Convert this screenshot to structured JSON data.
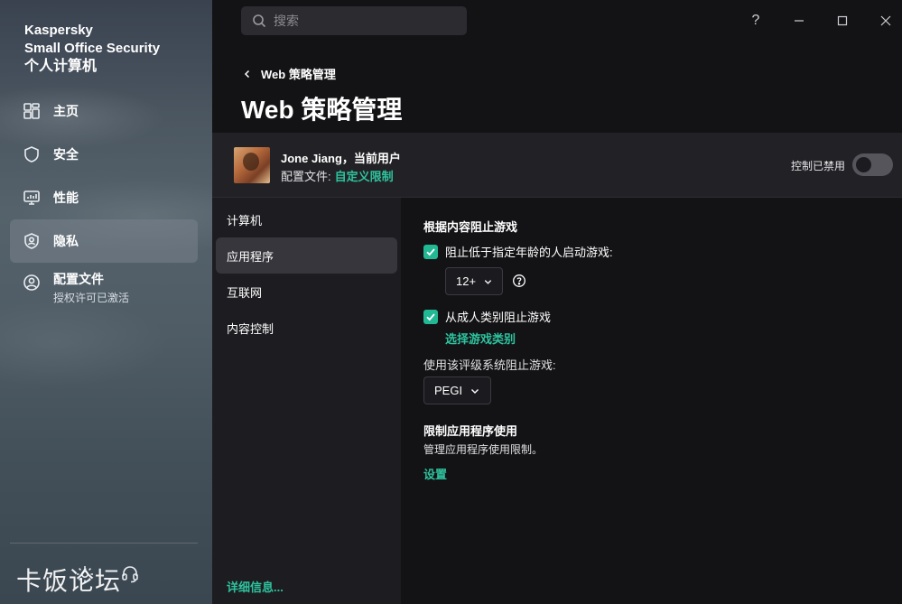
{
  "brand": {
    "line1": "Kaspersky",
    "line2": "Small Office Security",
    "line3": "个人计算机"
  },
  "sidebar": {
    "items": [
      {
        "label": "主页",
        "icon": "dashboard-icon"
      },
      {
        "label": "安全",
        "icon": "shield-icon"
      },
      {
        "label": "性能",
        "icon": "monitor-icon"
      },
      {
        "label": "隐私",
        "icon": "privacy-shield-icon",
        "active": true
      },
      {
        "label": "配置文件",
        "sublabel": "授权许可已激活",
        "icon": "user-circle-icon"
      }
    ],
    "footer_icons": [
      "settings-icon",
      "support-headset-icon"
    ],
    "watermark": "卡饭论坛"
  },
  "search": {
    "placeholder": "搜索"
  },
  "window_controls": {
    "help": "?",
    "minimize": "—",
    "maximize": "□",
    "close": "✕"
  },
  "header": {
    "breadcrumb": "Web 策略管理",
    "title": "Web 策略管理"
  },
  "user": {
    "name": "Jone Jiang，当前用户",
    "profile_label": "配置文件:",
    "profile_value": "自定义限制",
    "control_label": "控制已禁用",
    "control_enabled": false
  },
  "subnav": {
    "items": [
      {
        "label": "计算机"
      },
      {
        "label": "应用程序",
        "active": true
      },
      {
        "label": "互联网"
      },
      {
        "label": "内容控制"
      }
    ],
    "more_link": "详细信息..."
  },
  "content": {
    "section1_title": "根据内容阻止游戏",
    "age_block_label": "阻止低于指定年龄的人启动游戏:",
    "age_block_checked": true,
    "age_value": "12+",
    "adult_block_label": "从成人类别阻止游戏",
    "adult_block_checked": true,
    "choose_category_link": "选择游戏类别",
    "rating_system_label": "使用该评级系统阻止游戏:",
    "rating_system_value": "PEGI",
    "section2_title": "限制应用程序使用",
    "section2_desc": "管理应用程序使用限制。",
    "settings_link": "设置"
  },
  "colors": {
    "accent": "#2ec39e",
    "checkbox": "#22b894",
    "background": "#131316"
  }
}
